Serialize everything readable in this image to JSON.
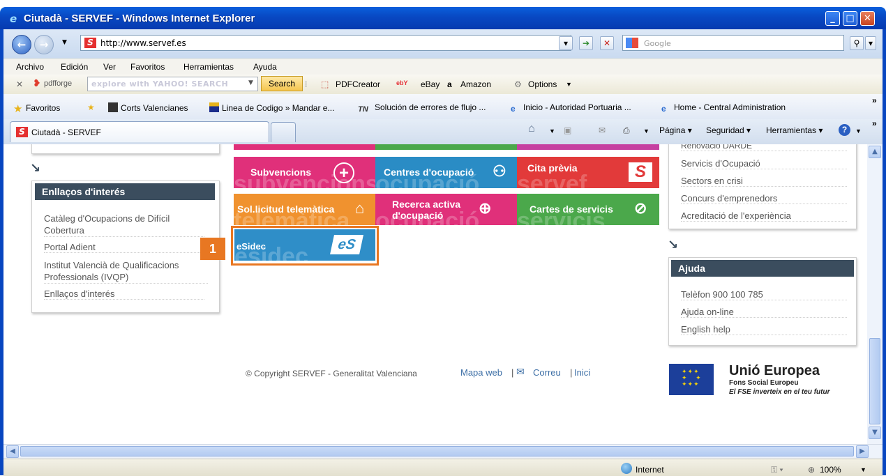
{
  "window": {
    "title": "Ciutadà - SERVEF - Windows Internet Explorer"
  },
  "address": {
    "url": "http://www.servef.es"
  },
  "search": {
    "placeholder": "Google"
  },
  "menu": [
    "Archivo",
    "Edición",
    "Ver",
    "Favoritos",
    "Herramientas",
    "Ayuda"
  ],
  "toolbar": {
    "pdfforge": "pdfforge",
    "yahoo_placeholder": "explore with YAHOO! SEARCH",
    "search_button": "Search",
    "pdfcreator": "PDFCreator",
    "ebay": "eBay",
    "amazon": "Amazon",
    "options": "Options"
  },
  "favorites": {
    "label": "Favoritos",
    "items": [
      "Corts Valencianes",
      "Linea de Codigo » Mandar e...",
      "Solución de errores de flujo ...",
      "Inicio - Autoridad Portuaria ...",
      "Home - Central Administration"
    ]
  },
  "tab": {
    "title": "Ciutadà - SERVEF"
  },
  "commandbar": {
    "page": "Página",
    "security": "Seguridad",
    "tools": "Herramientas"
  },
  "left_panel": {
    "title": "Enllaços d'interés",
    "links": [
      "Catàleg d'Ocupacions de Difícil Cobertura",
      "Portal Adient",
      "Institut Valencià de Qualificacions Professionals (IVQP)",
      "Enllaços d'interés"
    ]
  },
  "tiles": [
    {
      "label": "Subvencions",
      "ghost": "subvencions",
      "color": "#e0307a"
    },
    {
      "label": "Centres d'ocupació",
      "ghost": "ocupació",
      "color": "#2a8cc5"
    },
    {
      "label": "Cita prèvia",
      "ghost": "servef",
      "color": "#e23a3a"
    },
    {
      "label": "Sol.licitud telemàtica",
      "ghost": "telemàtica",
      "color": "#f0922f"
    },
    {
      "label": "Recerca activa d'ocupació",
      "ghost": "ocupació",
      "color": "#e0307a"
    },
    {
      "label": "Cartes de servicis",
      "ghost": "servicis",
      "color": "#4ba84b"
    },
    {
      "label": "eSidec",
      "ghost": "esidec",
      "color": "#2f8ec8"
    }
  ],
  "tile_icons": {
    "cita": "S",
    "esidec": "eS"
  },
  "highlight": {
    "number": "1",
    "color": "#e87722"
  },
  "right_top_links": [
    "Renovació DARDE",
    "Servicis d'Ocupació",
    "Sectors en crisi",
    "Concurs d'emprenedors",
    "Acreditació de l'experiència"
  ],
  "help_panel": {
    "title": "Ajuda",
    "links": [
      "Telèfon 900 100 785",
      "Ajuda on-line",
      "English help"
    ]
  },
  "footer": {
    "copyright": "© Copyright SERVEF - Generalitat Valenciana",
    "mapa": "Mapa web",
    "sep1": "|",
    "correu": "Correu",
    "sep2": "|",
    "inici": "Inici"
  },
  "eu": {
    "title": "Unió Europea",
    "subtitle": "Fons Social Europeu",
    "tagline": "El FSE inverteix en el teu futur"
  },
  "status": {
    "zone": "Internet",
    "zoom": "100%"
  }
}
